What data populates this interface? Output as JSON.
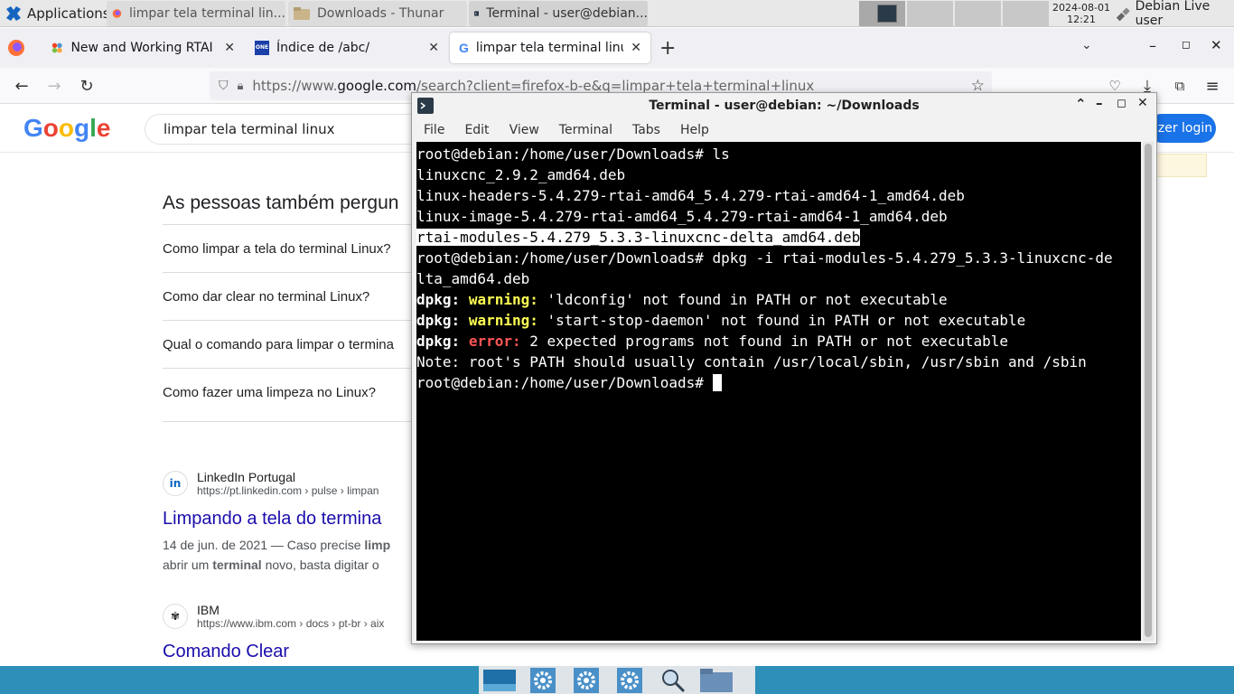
{
  "top_panel": {
    "apps_label": "Applications",
    "tasks": [
      {
        "label": "limpar tela terminal lin...",
        "icon": "firefox-icon"
      },
      {
        "label": "Downloads - Thunar",
        "icon": "folder-icon"
      },
      {
        "label": "Terminal - user@debian...",
        "icon": "terminal-icon"
      }
    ],
    "clock_date": "2024-08-01",
    "clock_time": "12:21",
    "user_label": "Debian Live user"
  },
  "firefox": {
    "tabs": [
      {
        "label": "New and Working RTAI de"
      },
      {
        "label": "Índice de /abc/"
      },
      {
        "label": "limpar tela terminal linux"
      }
    ],
    "url_prefix": "https://www.",
    "url_domain": "google.com",
    "url_rest": "/search?client=firefox-b-e&q=limpar+tela+terminal+linux"
  },
  "google": {
    "search_value": "limpar tela terminal linux",
    "login_label": "zer login",
    "paa_title": "As pessoas também pergun",
    "paa_items": [
      "Como limpar a tela do terminal Linux?",
      "Como dar clear no terminal Linux?",
      "Qual o comando para limpar o termina",
      "Como fazer uma limpeza no Linux?"
    ],
    "results": [
      {
        "source": "LinkedIn Portugal",
        "url": "https://pt.linkedin.com › pulse › limpan",
        "title": "Limpando a tela do termina",
        "snippet_1_pre": "14 de jun. de 2021 — Caso precise ",
        "snippet_1_bold": "limp",
        "snippet_2_pre": "abrir um ",
        "snippet_2_bold": "terminal",
        "snippet_2_post": " novo, basta digitar o"
      },
      {
        "source": "IBM",
        "url": "https://www.ibm.com › docs › pt-br › aix",
        "title": "Comando Clear"
      }
    ]
  },
  "terminal": {
    "title": "Terminal - user@debian: ~/Downloads",
    "menu": [
      "File",
      "Edit",
      "View",
      "Terminal",
      "Tabs",
      "Help"
    ],
    "lines": {
      "l1": "root@debian:/home/user/Downloads# ls",
      "l2": "linuxcnc_2.9.2_amd64.deb",
      "l3": "linux-headers-5.4.279-rtai-amd64_5.4.279-rtai-amd64-1_amd64.deb",
      "l4": "linux-image-5.4.279-rtai-amd64_5.4.279-rtai-amd64-1_amd64.deb",
      "l5": "rtai-modules-5.4.279_5.3.3-linuxcnc-delta_amd64.deb",
      "l6": "root@debian:/home/user/Downloads# dpkg -i rtai-modules-5.4.279_5.3.3-linuxcnc-de",
      "l7": "lta_amd64.deb",
      "l8_tag": "dpkg:",
      "l8_kind": "warning:",
      "l8_msg": " 'ldconfig' not found in PATH or not executable",
      "l9_tag": "dpkg:",
      "l9_kind": "warning:",
      "l9_msg": " 'start-stop-daemon' not found in PATH or not executable",
      "l10_tag": "dpkg:",
      "l10_kind": "error:",
      "l10_msg": " 2 expected programs not found in PATH or not executable",
      "l11": "Note: root's PATH should usually contain /usr/local/sbin, /usr/sbin and /sbin",
      "l12": "root@debian:/home/user/Downloads# "
    }
  }
}
